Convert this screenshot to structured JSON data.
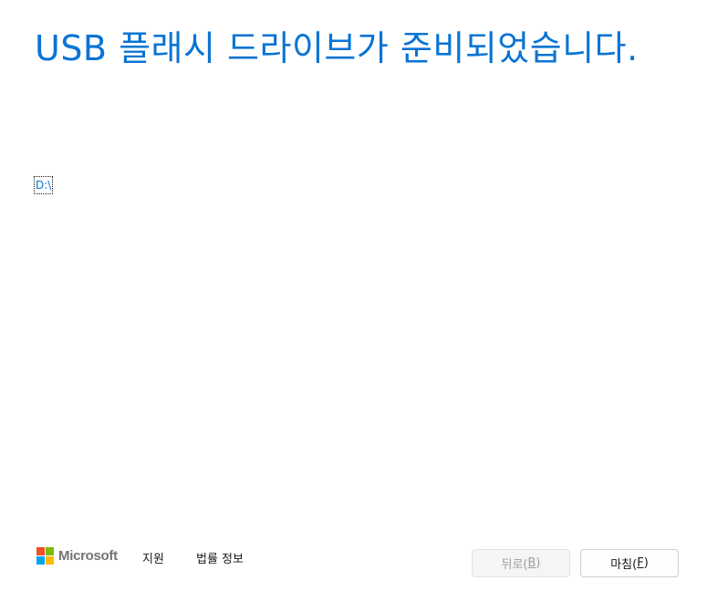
{
  "header": {
    "title": "USB 플래시 드라이브가 준비되었습니다."
  },
  "drive": {
    "path_label": "D:\\"
  },
  "footer": {
    "brand": "Microsoft",
    "support_label": "지원",
    "legal_label": "법률 정보"
  },
  "buttons": {
    "back": {
      "label": "뒤로(",
      "accel": "B",
      "suffix": ")",
      "enabled": false
    },
    "finish": {
      "label": "마침(",
      "accel": "F",
      "suffix": ")",
      "enabled": true
    }
  },
  "colors": {
    "accent": "#0a74d4",
    "logo_red": "#f25022",
    "logo_green": "#7fba00",
    "logo_blue": "#00a4ef",
    "logo_yellow": "#ffb900"
  }
}
